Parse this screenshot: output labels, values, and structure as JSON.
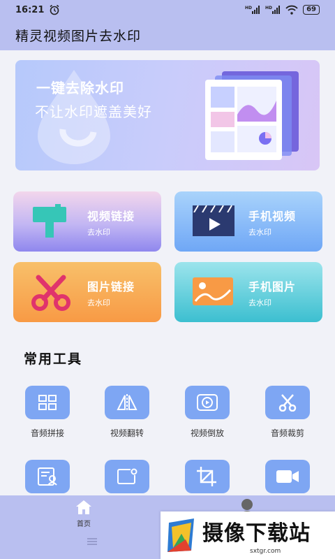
{
  "status_bar": {
    "time": "16:21",
    "battery": "69",
    "alarm_icon": "alarm-clock-icon"
  },
  "header": {
    "title": "精灵视频图片去水印"
  },
  "banner": {
    "line1": "一键去除水印",
    "line2": "不让水印遮盖美好"
  },
  "tiles": [
    {
      "title": "视频链接",
      "subtitle": "去水印",
      "icon": "paint-roller-icon"
    },
    {
      "title": "手机视频",
      "subtitle": "去水印",
      "icon": "video-play-icon"
    },
    {
      "title": "图片链接",
      "subtitle": "去水印",
      "icon": "scissors-icon"
    },
    {
      "title": "手机图片",
      "subtitle": "去水印",
      "icon": "image-icon"
    }
  ],
  "tools": {
    "title": "常用工具",
    "items": [
      {
        "label": "音频拼接",
        "icon": "grid-icon"
      },
      {
        "label": "视频翻转",
        "icon": "flip-icon"
      },
      {
        "label": "视频倒放",
        "icon": "reverse-play-icon"
      },
      {
        "label": "音频裁剪",
        "icon": "scissors-icon"
      },
      {
        "label": "",
        "icon": "id-card-icon"
      },
      {
        "label": "",
        "icon": "note-icon"
      },
      {
        "label": "",
        "icon": "crop-icon"
      },
      {
        "label": "",
        "icon": "camera-icon"
      }
    ]
  },
  "nav": {
    "home_label": "首页"
  },
  "overlay": {
    "text": "摄像下载站",
    "url": "sxtgr.com"
  },
  "colors": {
    "accent": "#b9bff0",
    "tool_icon_bg": "#7ea6f3"
  }
}
